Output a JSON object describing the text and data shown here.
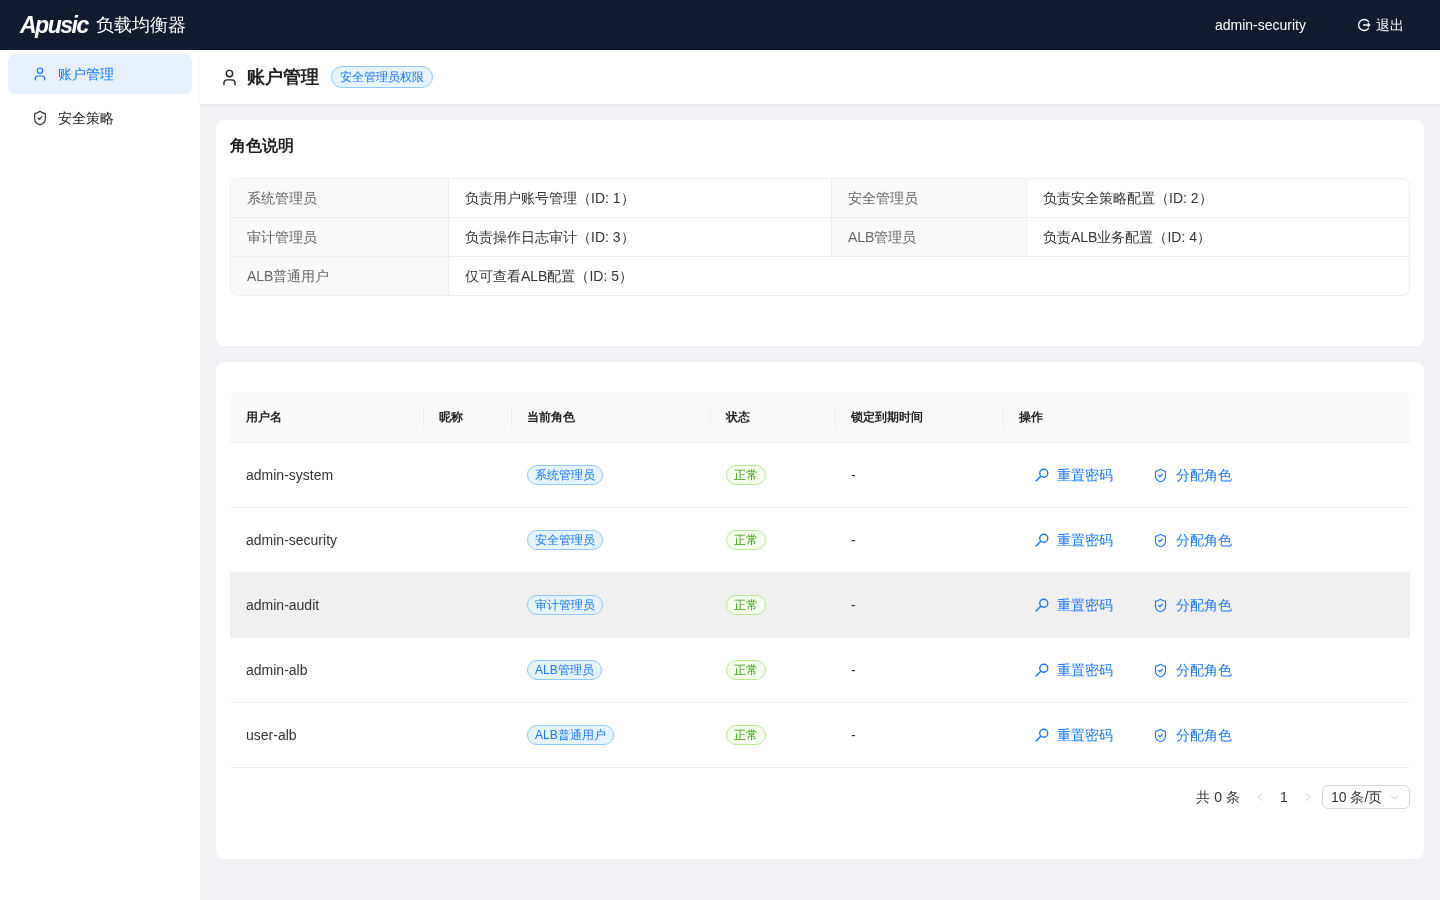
{
  "header": {
    "logo": "Apusic",
    "product_name": "负载均衡器",
    "user": "admin-security",
    "logout": "退出"
  },
  "sidebar": {
    "items": [
      {
        "kind": "account",
        "label": "账户管理",
        "selected": true
      },
      {
        "kind": "policy",
        "label": "安全策略",
        "selected": false
      }
    ]
  },
  "page_header": {
    "title": "账户管理",
    "tag": "安全管理员权限"
  },
  "role_card": {
    "title": "角色说明",
    "rows": [
      [
        {
          "label": "系统管理员",
          "value": "负责用户账号管理（ID: 1）"
        },
        {
          "label": "安全管理员",
          "value": "负责安全策略配置（ID: 2）"
        }
      ],
      [
        {
          "label": "审计管理员",
          "value": "负责操作日志审计（ID: 3）"
        },
        {
          "label": "ALB管理员",
          "value": "负责ALB业务配置（ID: 4）"
        }
      ],
      [
        {
          "label": "ALB普通用户",
          "value": "仅可查看ALB配置（ID: 5）"
        }
      ]
    ]
  },
  "users_card": {
    "columns": [
      "用户名",
      "昵称",
      "当前角色",
      "状态",
      "锁定到期时间",
      "操作"
    ],
    "rows": [
      {
        "username": "admin-system",
        "role": "系统管理员",
        "status": "正常",
        "lock_until": "-",
        "highlighted": false,
        "actions": [
          {
            "kind": "reset",
            "label": "重置密码"
          },
          {
            "kind": "assign",
            "label": "分配角色"
          }
        ]
      },
      {
        "username": "admin-security",
        "role": "安全管理员",
        "status": "正常",
        "lock_until": "-",
        "highlighted": false,
        "actions": [
          {
            "kind": "reset",
            "label": "重置密码"
          },
          {
            "kind": "assign",
            "label": "分配角色"
          }
        ]
      },
      {
        "username": "admin-audit",
        "role": "审计管理员",
        "status": "正常",
        "lock_until": "-",
        "highlighted": true,
        "actions": [
          {
            "kind": "reset",
            "label": "重置密码"
          },
          {
            "kind": "assign",
            "label": "分配角色"
          }
        ]
      },
      {
        "username": "admin-alb",
        "role": "ALB管理员",
        "status": "正常",
        "lock_until": "-",
        "highlighted": false,
        "actions": [
          {
            "kind": "reset",
            "label": "重置密码"
          },
          {
            "kind": "assign",
            "label": "分配角色"
          }
        ]
      },
      {
        "username": "user-alb",
        "role": "ALB普通用户",
        "status": "正常",
        "lock_until": "-",
        "highlighted": false,
        "actions": [
          {
            "kind": "reset",
            "label": "重置密码"
          },
          {
            "kind": "assign",
            "label": "分配角色"
          }
        ]
      }
    ],
    "pagination": {
      "total": "共 0 条",
      "current_page": "1",
      "page_size": "10 条/页",
      "prev_disabled": true,
      "next_disabled": true
    }
  }
}
